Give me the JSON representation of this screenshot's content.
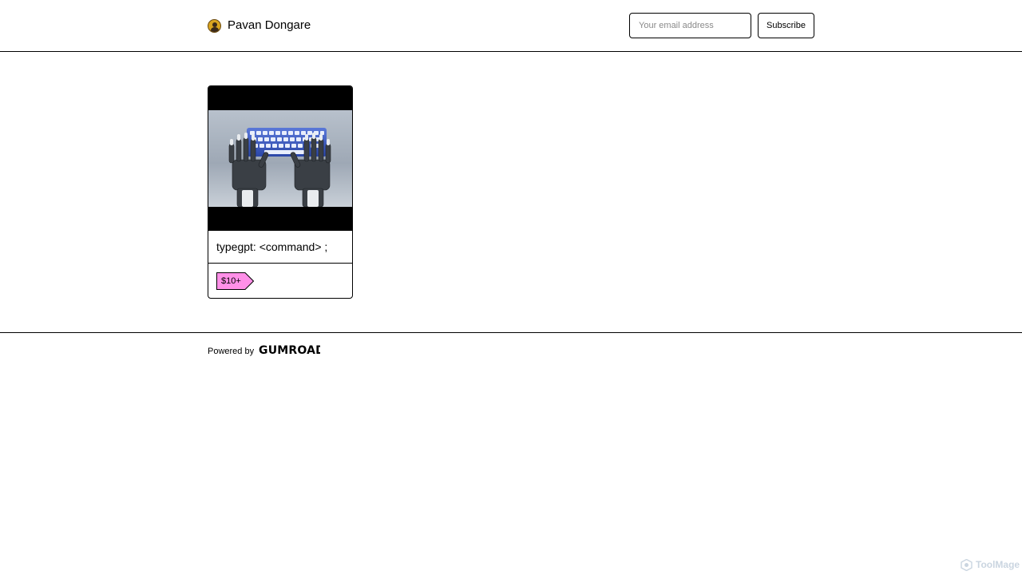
{
  "header": {
    "creator_name": "Pavan Dongare",
    "avatar_icon": "creator-avatar",
    "email_placeholder": "Your email address",
    "email_value": "",
    "subscribe_label": "Subscribe"
  },
  "products": [
    {
      "title": "typegpt: <command> ;",
      "price": "$10+",
      "thumbnail_icon": "robot-hands-typing-keyboard",
      "price_tag_color": "#ff90e8"
    }
  ],
  "footer": {
    "powered_by": "Powered by",
    "brand_logo": "gumroad"
  },
  "watermark": {
    "text": "ToolMage"
  },
  "colors": {
    "background": "#ffffff",
    "border": "#000000",
    "price_tag": "#ff90e8"
  }
}
